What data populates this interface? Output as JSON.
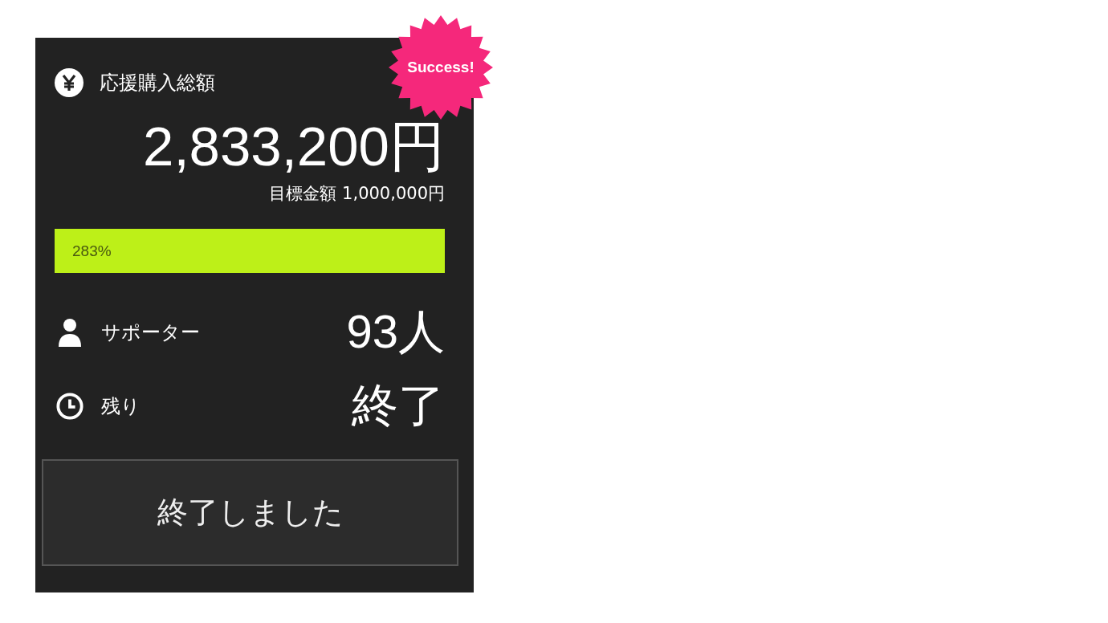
{
  "badge": {
    "label": "Success!"
  },
  "total": {
    "label": "応援購入総額",
    "amount": "2,833,200円",
    "goal": "目標金額 1,000,000円"
  },
  "progress": {
    "level": 1,
    "label": "283%"
  },
  "stats": [
    {
      "kind": "supporters",
      "label": "サポーター",
      "value": "93人"
    },
    {
      "kind": "remaining",
      "label": "残り",
      "value": "終了"
    }
  ],
  "button": {
    "label": "終了しました",
    "disabled": true
  }
}
